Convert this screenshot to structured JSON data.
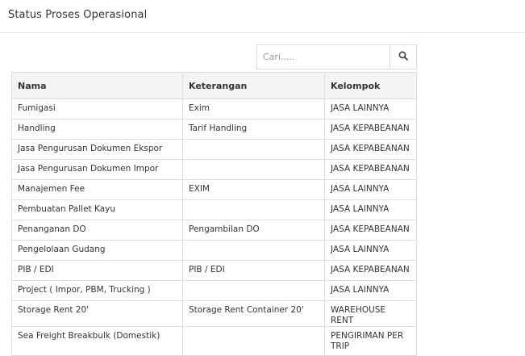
{
  "header": {
    "title": "Status Proses Operasional"
  },
  "search": {
    "placeholder": "Cari.....",
    "value": ""
  },
  "table": {
    "columns": [
      "Nama",
      "Keterangan",
      "Kelompok"
    ],
    "rows": [
      [
        "Fumigasi",
        "Exim",
        "JASA LAINNYA"
      ],
      [
        "Handling",
        "Tarif Handling",
        "JASA KEPABEANAN"
      ],
      [
        "Jasa Pengurusan Dokumen Ekspor",
        "",
        "JASA KEPABEANAN"
      ],
      [
        "Jasa Pengurusan Dokumen Impor",
        "",
        "JASA KEPABEANAN"
      ],
      [
        "Manajemen Fee",
        "EXIM",
        "JASA LAINNYA"
      ],
      [
        "Pembuatan Pallet Kayu",
        "",
        "JASA LAINNYA"
      ],
      [
        "Penanganan DO",
        "Pengambilan DO",
        "JASA KEPABEANAN"
      ],
      [
        "Pengelolaan Gudang",
        "",
        "JASA LAINNYA"
      ],
      [
        "PIB / EDI",
        "PIB / EDI",
        "JASA KEPABEANAN"
      ],
      [
        "Project ( Impor, PBM, Trucking )",
        "",
        "JASA LAINNYA"
      ],
      [
        "Storage Rent 20'",
        "Storage Rent Container 20'",
        "WAREHOUSE RENT"
      ],
      [
        "Sea Freight Breakbulk (Domestik)",
        "",
        "PENGIRIMAN PER TRIP"
      ]
    ]
  }
}
